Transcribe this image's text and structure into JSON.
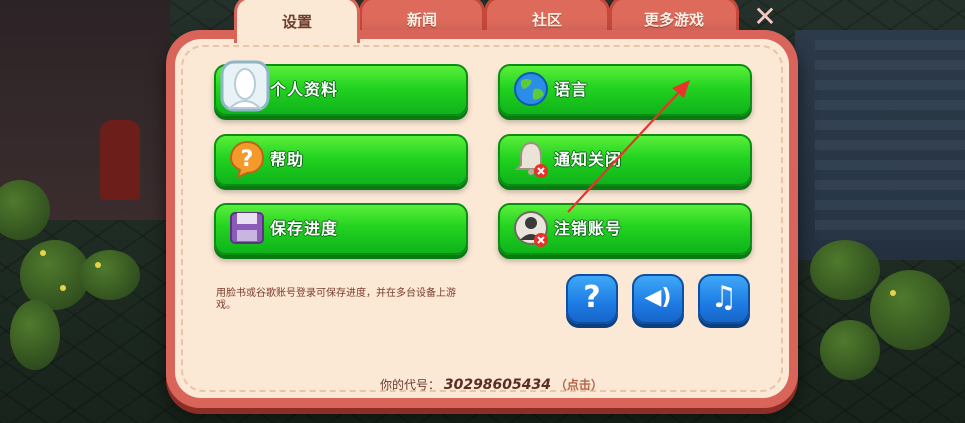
{
  "tabs": [
    {
      "label": "设置",
      "active": true
    },
    {
      "label": "新闻",
      "active": false
    },
    {
      "label": "社区",
      "active": false
    },
    {
      "label": "更多游戏",
      "active": false
    }
  ],
  "close_label": "✕",
  "buttons": {
    "profile": {
      "label": "个人资料",
      "icon": "avatar-silhouette-icon"
    },
    "help": {
      "label": "帮助",
      "icon": "question-bubble-icon"
    },
    "save": {
      "label": "保存进度",
      "icon": "floppy-disk-icon"
    },
    "language": {
      "label": "语言",
      "icon": "globe-icon"
    },
    "notifications": {
      "label": "通知关闭",
      "icon": "bell-off-icon"
    },
    "delete_account": {
      "label": "注销账号",
      "icon": "user-remove-icon"
    }
  },
  "round_buttons": [
    {
      "name": "help",
      "icon": "question-icon",
      "glyph": "?"
    },
    {
      "name": "sound",
      "icon": "speaker-icon",
      "glyph": "◀)"
    },
    {
      "name": "music",
      "icon": "music-note-icon",
      "glyph": "♫"
    }
  ],
  "hint_text": "用脸书或谷歌账号登录可保存进度，并在多台设备上游戏。",
  "player_code": {
    "label": "你的代号：",
    "value": "30298605434",
    "tap_text": "（点击）"
  },
  "colors": {
    "dialog_border": "#d9655a",
    "dialog_fill": "#fbe8d5",
    "button_green": "#23d320",
    "button_blue": "#1e7be3",
    "annotation_arrow": "#e8342a"
  }
}
